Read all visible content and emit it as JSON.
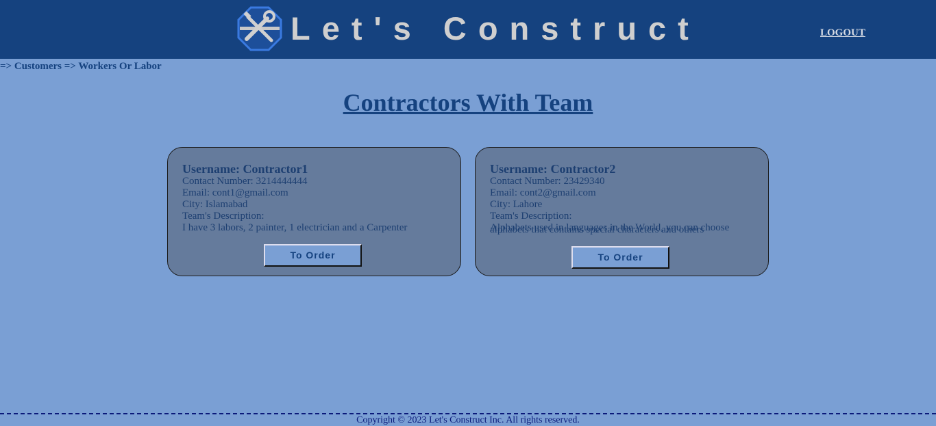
{
  "header": {
    "brand": "Let's Construct",
    "logout_label": "LOGOUT",
    "logo_icon": "tools-icon"
  },
  "breadcrumb": "=> Customers => Workers Or Labor",
  "page_title": "Contractors With Team",
  "cards": [
    {
      "username": "Username: Contractor1",
      "contact": "Contact Number: 3214444444",
      "email": "Email: cont1@gmail.com",
      "city": "City: Islamabad",
      "desc_label": "Team's Description:",
      "desc": "I have 3 labors, 2 painter, 1 electrician and a Carpenter",
      "button": "To Order"
    },
    {
      "username": "Username: Contractor2",
      "contact": "Contact Number: 23429340",
      "email": "Email: cont2@gmail.com",
      "city": "City: Lahore",
      "desc_label": "Team's Description:",
      "desc_line_a": "Alphabets used in languages in the World, you can choose",
      "desc_line_b": "alphabets that contains special characters and others",
      "button": "To Order"
    }
  ],
  "footer": "Copyright © 2023 Let's Construct Inc. All rights reserved.",
  "colors": {
    "header_bg": "#15427f",
    "page_bg": "#7a9fd4",
    "card_bg": "#657b9c",
    "accent_text": "#15427f"
  }
}
